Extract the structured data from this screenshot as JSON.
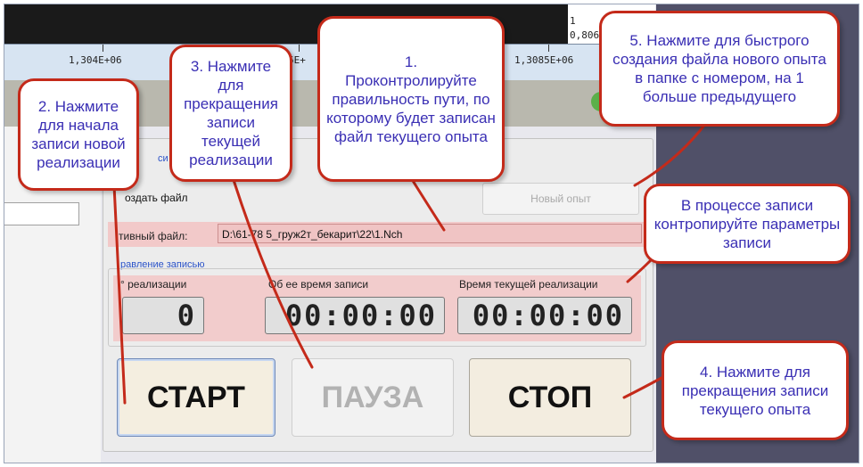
{
  "plot": {
    "axis_ticks": [
      "1,304E+06",
      "5E+",
      "1,3085E+06"
    ],
    "right_labels": [
      "1",
      "0,806"
    ]
  },
  "panel": {
    "group_title_fragment": "си",
    "create_file_label": "оздать файл",
    "new_experiment_button": "Новый опыт",
    "active_file_label": "тивный файл:",
    "active_file_path": "D:\\61-78 5_груж2т_бекарит\\22\\1.Nch",
    "record_group_title": "равление записью",
    "columns": {
      "realization": "° реализации",
      "total_time": "Об  ее время записи",
      "current_time": "Время текущей реализации"
    },
    "values": {
      "realization": "0",
      "total_time": "00:00:00",
      "current_time": "00:00:00"
    },
    "buttons": {
      "start": "СТАРТ",
      "pause": "ПАУЗА",
      "stop": "СТОП"
    }
  },
  "callouts": {
    "c1": "1.\nПроконтролируйте правильность пути, по которому будет записан файл текущего опыта",
    "c2": "2. Нажмите для начала записи новой реализации",
    "c3": "3. Нажмите для прекращения записи текущей реализации",
    "c4": "4. Нажмите для прекращения записи текущего опыта",
    "c5": "5. Нажмите для быстрого создания файла нового опыта в папке с номером, на 1 больше предыдущего",
    "c6": "В процессе записи контропируйте параметры записи"
  },
  "colors": {
    "callout_border": "#c42a1a",
    "callout_text": "#3a2fb4",
    "highlight": "#f2c9c9"
  }
}
